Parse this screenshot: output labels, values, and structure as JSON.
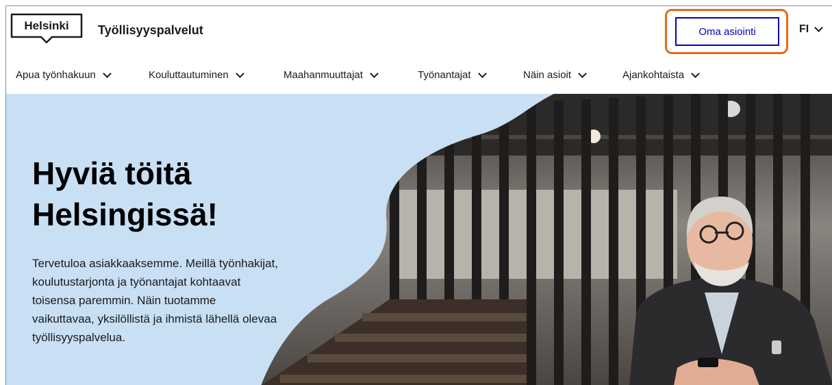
{
  "header": {
    "logo_text": "Helsinki",
    "service_name": "Työllisyyspalvelut",
    "login_label": "Oma asiointi",
    "language": "FI"
  },
  "nav": {
    "items": [
      {
        "label": "Apua työnhakuun"
      },
      {
        "label": "Kouluttautuminen"
      },
      {
        "label": "Maahanmuuttajat"
      },
      {
        "label": "Työnantajat"
      },
      {
        "label": "Näin asioit"
      },
      {
        "label": "Ajankohtaista"
      }
    ]
  },
  "hero": {
    "title_line1": "Hyviä töitä",
    "title_line2": "Helsingissä!",
    "body": "Tervetuloa asiakkaaksemme. Meillä työnhakijat, koulutustarjonta ja työnantajat kohtaavat toisensa paremmin. Näin tuotamme vaikuttavaa, yksilöllistä ja ihmistä lähellä olevaa työllisyyspalvelua."
  },
  "colors": {
    "brand_blue": "#0000bf",
    "hero_background": "#c8dff4",
    "highlight_orange": "#e8661e"
  }
}
